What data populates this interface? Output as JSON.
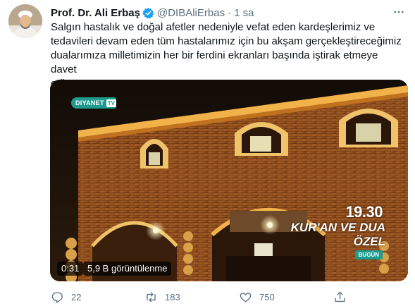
{
  "tweet": {
    "display_name": "Prof. Dr. Ali Erbaş",
    "handle": "@DIBAliErbas",
    "separator": "·",
    "time": "1 sa",
    "text": "Salgın hastalık ve doğal afetler nedeniyle vefat eden kardeşlerimiz ve\ntedavileri devam eden tüm hastalarımız için bu akşam gerçekleştireceğimiz\ndualarımıza milletimizin her bir ferdini ekranları başında iştirak etmeye davet\nediyorum.",
    "more_icon": "more-horizontal-icon",
    "verified_icon": "verified-badge-icon"
  },
  "video": {
    "channel_logo_text": "DIYANET",
    "channel_logo_suffix": "TV",
    "overlay_time": "19.30",
    "overlay_title_line1": "KUR'AN VE DUA",
    "overlay_title_line2": "ÖZEL",
    "overlay_tag": "BUGÜN",
    "duration": "0:31",
    "views": "5,9 B görüntülenme"
  },
  "actions": {
    "reply_count": "22",
    "retweet_count": "183",
    "like_count": "750",
    "reply_icon": "reply-icon",
    "retweet_icon": "retweet-icon",
    "like_icon": "heart-icon",
    "share_icon": "share-icon"
  },
  "colors": {
    "text": "#0f1419",
    "secondary": "#5b7083",
    "verified": "#1da1f2",
    "channel_teal": "#1f9a8e"
  }
}
